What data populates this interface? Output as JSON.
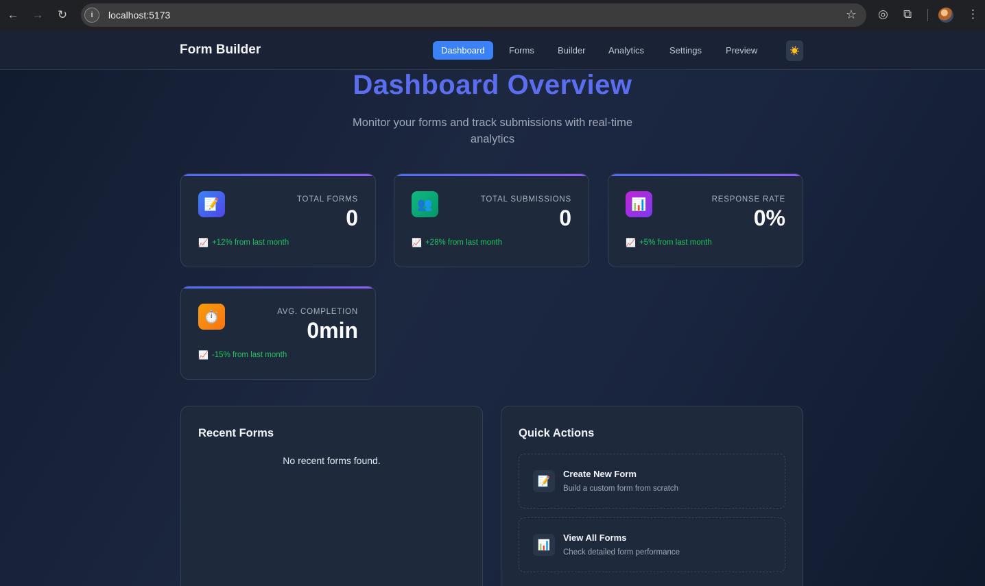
{
  "browser": {
    "url": "localhost:5173",
    "back_icon": "arrow-left-icon",
    "forward_icon": "arrow-right-icon",
    "reload_icon": "reload-icon"
  },
  "header": {
    "brand": "Form Builder",
    "nav": [
      "Dashboard",
      "Forms",
      "Builder",
      "Analytics",
      "Settings",
      "Preview"
    ],
    "active_nav": "Dashboard",
    "theme_icon": "☀️"
  },
  "page": {
    "title": "Dashboard Overview",
    "subtitle": "Monitor your forms and track submissions with real-time analytics"
  },
  "stats": [
    {
      "icon": "📝",
      "label": "TOTAL FORMS",
      "value": "0",
      "trend": "+12% from last month",
      "color": "#3b66f0"
    },
    {
      "icon": "👥",
      "label": "TOTAL SUBMISSIONS",
      "value": "0",
      "trend": "+28% from last month",
      "color": "#10b981"
    },
    {
      "icon": "📊",
      "label": "RESPONSE RATE",
      "value": "0%",
      "trend": "+5% from last month",
      "color": "#a21caf"
    },
    {
      "icon": "⏱️",
      "label": "AVG. COMPLETION",
      "value": "0min",
      "trend": "-15% from last month",
      "color": "#f59e0b"
    }
  ],
  "trend_icon": "📈",
  "recent_forms": {
    "title": "Recent Forms",
    "empty": "No recent forms found."
  },
  "quick_actions": {
    "title": "Quick Actions",
    "items": [
      {
        "icon": "📝",
        "title": "Create New Form",
        "desc": "Build a custom form from scratch"
      },
      {
        "icon": "📊",
        "title": "View All Forms",
        "desc": "Check detailed form performance"
      }
    ]
  }
}
